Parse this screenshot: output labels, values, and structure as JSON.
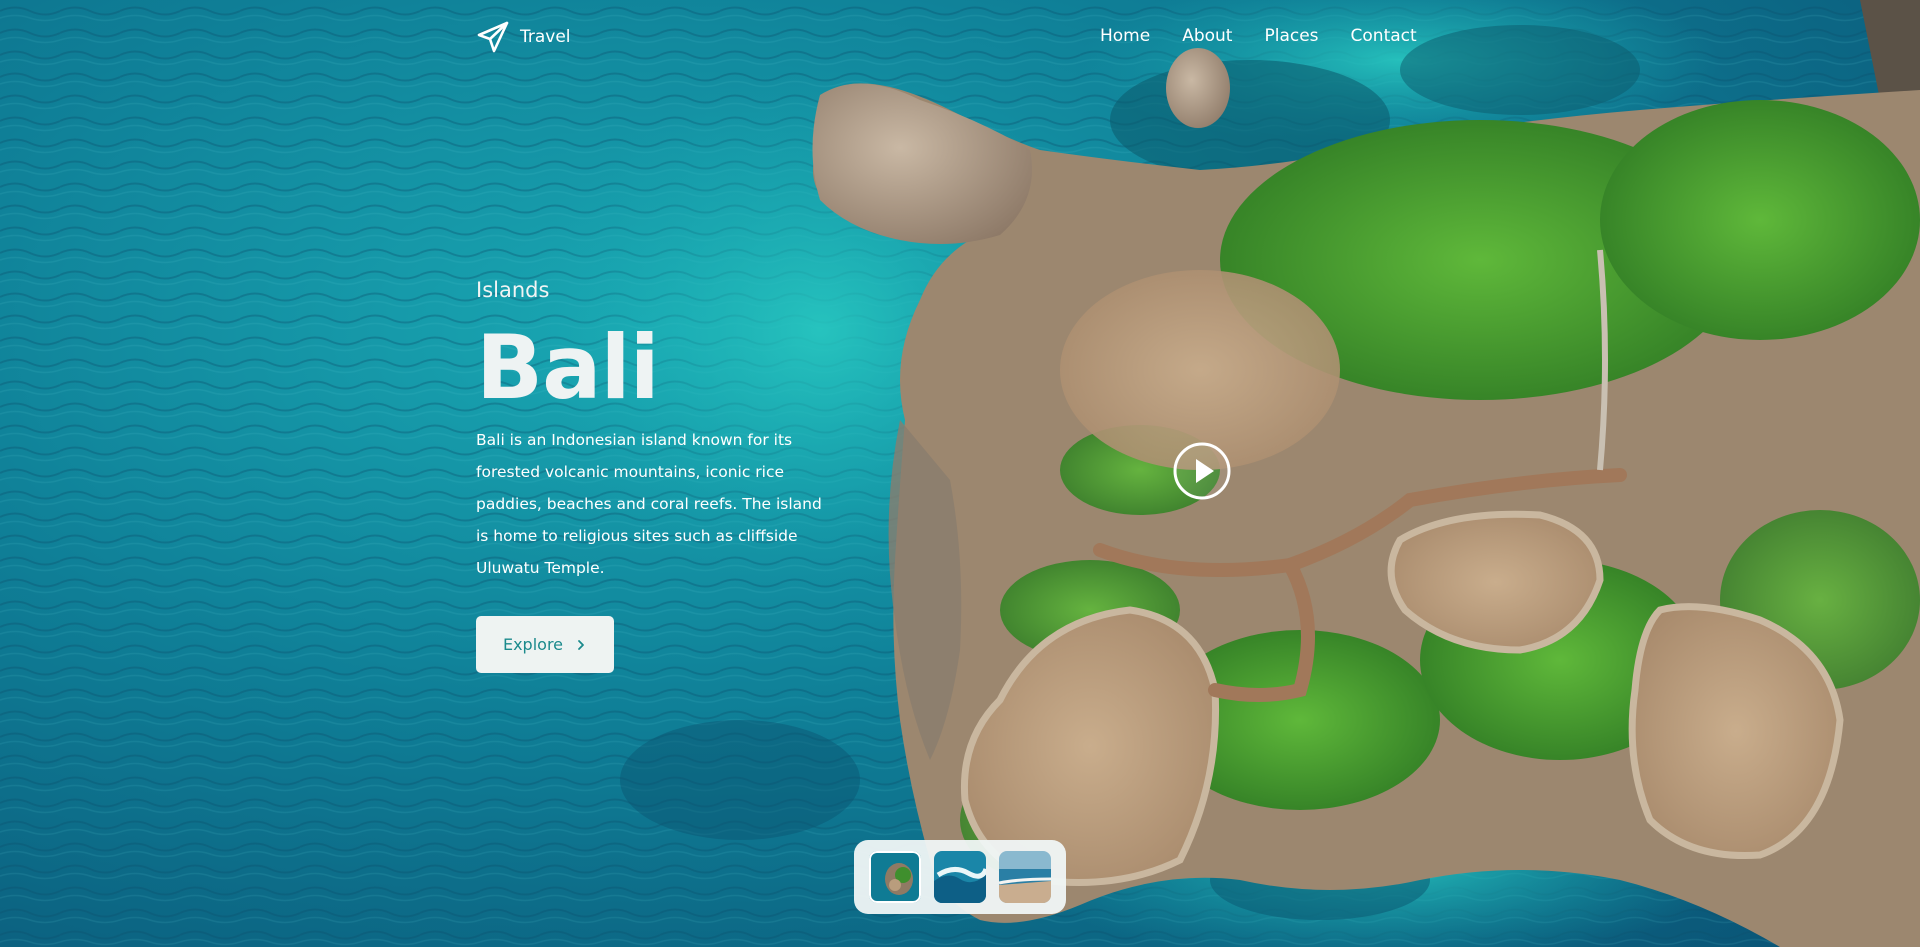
{
  "brand": {
    "name": "Travel",
    "icon": "paper-plane-icon"
  },
  "nav": {
    "items": [
      {
        "label": "Home"
      },
      {
        "label": "About"
      },
      {
        "label": "Places"
      },
      {
        "label": "Contact"
      }
    ]
  },
  "hero": {
    "eyebrow": "Islands",
    "title": "Bali",
    "description": "Bali is an Indonesian island known for its forested volcanic mountains, iconic rice paddies, beaches and coral reefs. The island is home to religious sites such as cliffside Uluwatu Temple.",
    "cta_label": "Explore",
    "cta_icon": "chevron-right-icon"
  },
  "media": {
    "play_icon": "play-icon"
  },
  "thumbnails": [
    {
      "name": "island-aerial",
      "active": true
    },
    {
      "name": "wave-beach",
      "active": false
    },
    {
      "name": "coast-shore",
      "active": false
    }
  ],
  "colors": {
    "ocean_deep": "#0b5f7e",
    "ocean_shallow": "#18b6b8",
    "cliff": "#b59a7d",
    "vegetation": "#3d8f2a",
    "button_bg": "#eef3f2",
    "button_text": "#1b8a8c"
  }
}
